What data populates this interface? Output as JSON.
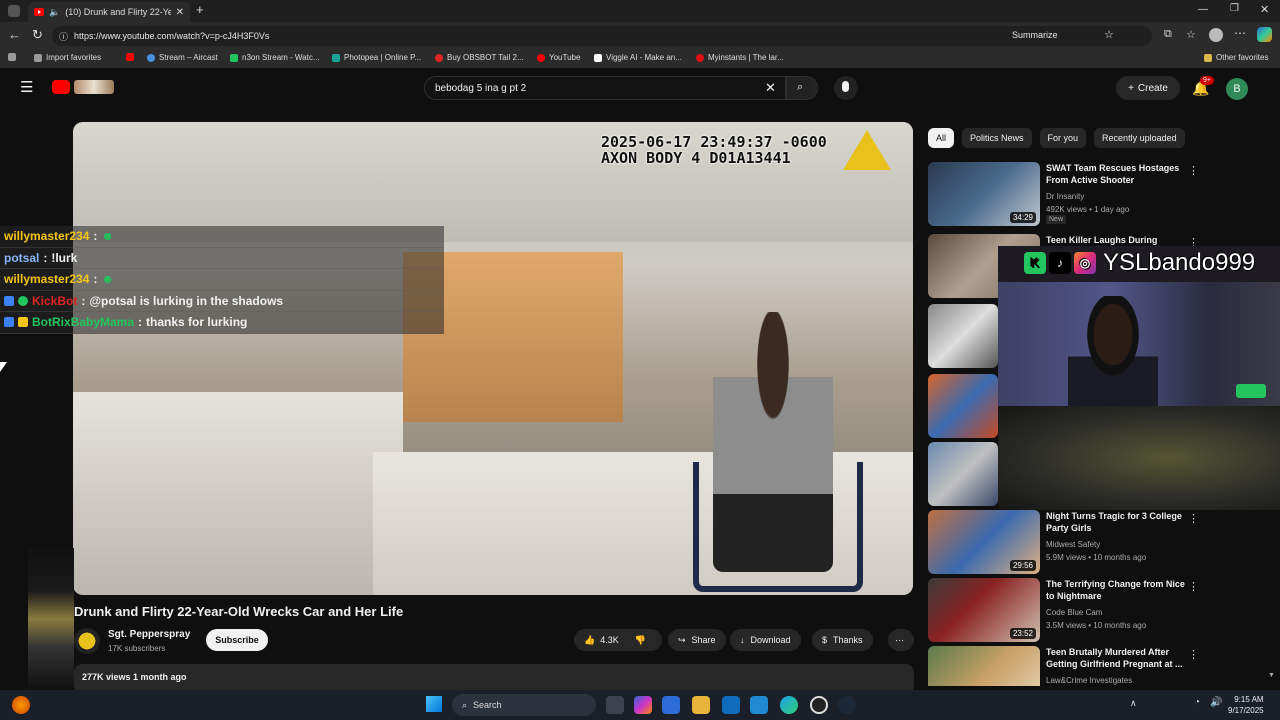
{
  "browser": {
    "tab_title": "(10) Drunk and Flirty 22-Year-",
    "url": "https://www.youtube.com/watch?v=p-cJ4H3F0Vs",
    "summarize_label": "Summarize"
  },
  "bookmarks": [
    {
      "label": "Import favorites",
      "color": "#9a9a9a"
    },
    {
      "label": "",
      "color": "#ff0000"
    },
    {
      "label": "Stream – Aircast",
      "color": "#4a90e2"
    },
    {
      "label": "n3on Stream - Watc...",
      "color": "#22c55e"
    },
    {
      "label": "Photopea | Online P...",
      "color": "#18a497"
    },
    {
      "label": "Buy OBSBOT Tail 2...",
      "color": "#e02424"
    },
    {
      "label": "YouTube",
      "color": "#ff0000"
    },
    {
      "label": "Viggle AI - Make an...",
      "color": "#ffffff"
    },
    {
      "label": "Myinstants | The lar...",
      "color": "#d11"
    }
  ],
  "bookmarks_other": "Other favorites",
  "youtube": {
    "search_value": "bebodag 5 ina g pt 2",
    "create_label": "Create",
    "notifications_badge": "9+",
    "avatar_letter": "B"
  },
  "video": {
    "bodycam_line1": "2025-06-17 23:49:37 -0600",
    "bodycam_line2": "AXON BODY 4 D01A13441",
    "title": "Drunk and Flirty 22-Year-Old Wrecks Car and Her Life",
    "channel": "Sgt. Pepperspray",
    "subscribers": "17K subscribers",
    "subscribe_label": "Subscribe",
    "likes": "4.3K",
    "share_label": "Share",
    "download_label": "Download",
    "thanks_label": "Thanks",
    "views_date": "277K views  1 month ago"
  },
  "chat": [
    {
      "user": "willymaster234",
      "sep": " : ",
      "msg": "",
      "color": "#f5c518"
    },
    {
      "user": "potsal",
      "sep": " : ",
      "msg": "!lurk",
      "color": "#8ab4f8"
    },
    {
      "user": "willymaster234",
      "sep": " : ",
      "msg": "",
      "color": "#f5c518"
    },
    {
      "user": "KickBot",
      "sep": " : ",
      "msg": "@potsal is lurking in the shadows",
      "color": "#e02424"
    },
    {
      "user": "BotRixBabyMama",
      "sep": " : ",
      "msg": "thanks for lurking",
      "color": "#22c55e"
    }
  ],
  "chips": [
    "All",
    "Politics News",
    "For you",
    "Recently uploaded"
  ],
  "recommendations": [
    {
      "title": "SWAT Team Rescues Hostages From Active Shooter",
      "channel": "Dr Insanity",
      "stats": "492K views • 1 day ago",
      "duration": "34:29",
      "badge": "New",
      "thumb": "#4a6a8c"
    },
    {
      "title": "Teen Killer Laughs During",
      "channel": "",
      "stats": "",
      "duration": "",
      "badge": "",
      "thumb": "#7a6a5c"
    },
    {
      "title": "",
      "channel": "",
      "stats": "",
      "duration": "",
      "badge": "",
      "thumb": "#a8a8a8"
    },
    {
      "title": "",
      "channel": "",
      "stats": "",
      "duration": "",
      "badge": "",
      "thumb": "#c84a20"
    },
    {
      "title": "",
      "channel": "",
      "stats": "",
      "duration": "",
      "badge": "",
      "thumb": "#6a8ab0"
    },
    {
      "title": "Night Turns Tragic for 3 College Party Girls",
      "channel": "Midwest Safety",
      "stats": "5.9M views • 10 months ago",
      "duration": "29:56",
      "badge": "",
      "thumb": "#a8552a"
    },
    {
      "title": "The Terrifying Change from Nice to Nightmare",
      "channel": "Code Blue Cam",
      "stats": "3.5M views • 10 months ago",
      "duration": "23:52",
      "badge": "",
      "thumb": "#8a2222"
    },
    {
      "title": "Teen Brutally Murdered After Getting Girlfriend Pregnant at ...",
      "channel": "Law&Crime Investigates",
      "stats": "",
      "duration": "",
      "badge": "",
      "thumb": "#c9a068"
    }
  ],
  "overlay": {
    "handle": "YSLbando999"
  },
  "taskbar": {
    "search_label": "Search",
    "time": "9:15 AM",
    "date": "9/17/2025"
  }
}
